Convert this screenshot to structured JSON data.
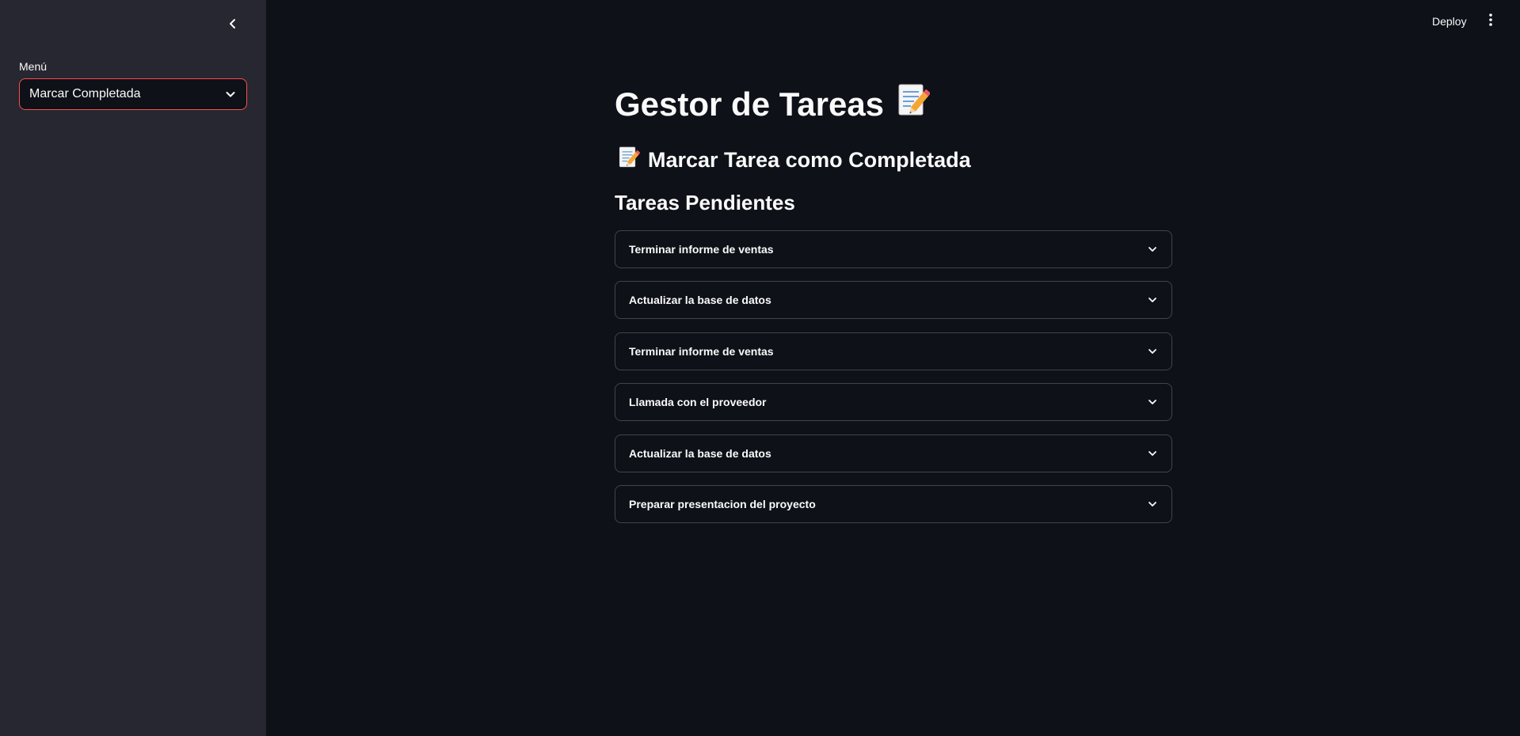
{
  "sidebar": {
    "collapse_icon": "chevron-left-icon",
    "menu_label": "Menú",
    "select": {
      "value": "Marcar Completada",
      "icon": "chevron-down-icon",
      "accent_color": "#ff4b4b"
    }
  },
  "header": {
    "deploy_label": "Deploy",
    "menu_icon": "vertical-dots-icon"
  },
  "main": {
    "title": "Gestor de Tareas",
    "title_icon": "memo-icon",
    "subtitle": "Marcar Tarea como Completada",
    "subtitle_icon": "memo-icon",
    "section_title": "Tareas Pendientes",
    "tasks": [
      {
        "label": "Terminar informe de ventas"
      },
      {
        "label": "Actualizar la base de datos"
      },
      {
        "label": "Terminar informe de ventas"
      },
      {
        "label": "Llamada con el proveedor"
      },
      {
        "label": "Actualizar la base de datos"
      },
      {
        "label": "Preparar presentacion del proyecto"
      }
    ]
  },
  "colors": {
    "background": "#0e1117",
    "sidebar": "#262730",
    "text": "#fafafa",
    "accent": "#ff4b4b"
  }
}
